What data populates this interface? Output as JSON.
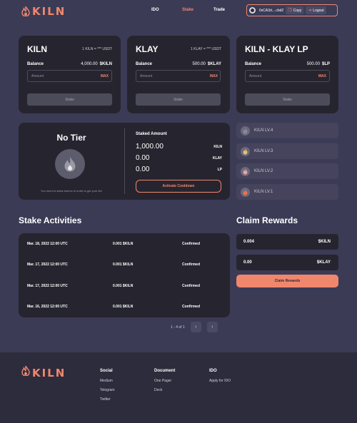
{
  "header": {
    "logo_text": "KILN",
    "nav": [
      {
        "label": "IDO"
      },
      {
        "label": "Stake"
      },
      {
        "label": "Trade"
      }
    ],
    "wallet": {
      "address": "0xCA3d....cbd2",
      "copy_label": "Copy",
      "logout_label": "Logout"
    }
  },
  "stake_cards": [
    {
      "title": "KILN",
      "rate": "1 KILN = *** USDT",
      "balance_label": "Balance",
      "balance_value": "4,000.00",
      "balance_unit": "$KILN",
      "amount_placeholder": "Amount",
      "max_label": "MAX",
      "stake_label": "Stake"
    },
    {
      "title": "KLAY",
      "rate": "1 KLAY = *** USDT",
      "balance_label": "Balance",
      "balance_value": "500.00",
      "balance_unit": "$KLAY",
      "amount_placeholder": "Amount",
      "max_label": "MAX",
      "stake_label": "Stake"
    },
    {
      "title": "KILN - KLAY LP",
      "rate": "",
      "balance_label": "Balance",
      "balance_value": "500.00",
      "balance_unit": "$LP",
      "amount_placeholder": "Amount",
      "max_label": "MAX",
      "stake_label": "Stake"
    }
  ],
  "tier": {
    "name": "No Tier",
    "note": "You need to stake tokens in order to get your tier",
    "staked_title": "Staked Amount",
    "rows": [
      {
        "value": "1,000.00",
        "unit": "KILN"
      },
      {
        "value": "0.00",
        "unit": "KLAY"
      },
      {
        "value": "0.00",
        "unit": "LP"
      }
    ],
    "cooldown_label": "Activate Cooldown"
  },
  "levels": [
    {
      "label": "KILN LV.4",
      "icon": "flame-icon",
      "color": "#8a8a9a"
    },
    {
      "label": "KILN LV.3",
      "icon": "flame-icon",
      "color": "#e8c070"
    },
    {
      "label": "KILN LV.2",
      "icon": "flame-icon",
      "color": "#f0a0a0"
    },
    {
      "label": "KILN LV.1",
      "icon": "flame-icon",
      "color": "#f07050"
    }
  ],
  "activities": {
    "title": "Stake Activities",
    "rows": [
      {
        "date": "Mar. 18, 2022 12:00 UTC",
        "amount": "0.001 $KILN",
        "status": "Confirmed"
      },
      {
        "date": "Mar. 17, 2022 12:00 UTC",
        "amount": "0.001 $KILN",
        "status": "Confirmed"
      },
      {
        "date": "Mar. 17, 2022 12:00 UTC",
        "amount": "0.001 $KILN",
        "status": "Confirmed"
      },
      {
        "date": "Mar. 16, 2022 12:00 UTC",
        "amount": "0.001 $KILN",
        "status": "Confirmed"
      }
    ],
    "pagination": "1 - 4 of 1"
  },
  "rewards": {
    "title": "Claim Rewards",
    "items": [
      {
        "value": "0.004",
        "unit": "$KILN"
      },
      {
        "value": "0.00",
        "unit": "$KLAY"
      }
    ],
    "claim_label": "Claim Rewards"
  },
  "footer": {
    "logo_text": "KILN",
    "columns": [
      {
        "heading": "Social",
        "links": [
          "Medium",
          "Telegram",
          "Twitter"
        ]
      },
      {
        "heading": "Document",
        "links": [
          "One Pager",
          "Deck"
        ]
      },
      {
        "heading": "IDO",
        "links": [
          "Apply for IDO"
        ]
      }
    ]
  },
  "colors": {
    "accent": "#f0876d",
    "background": "#3b3b56",
    "card": "#26252f"
  }
}
